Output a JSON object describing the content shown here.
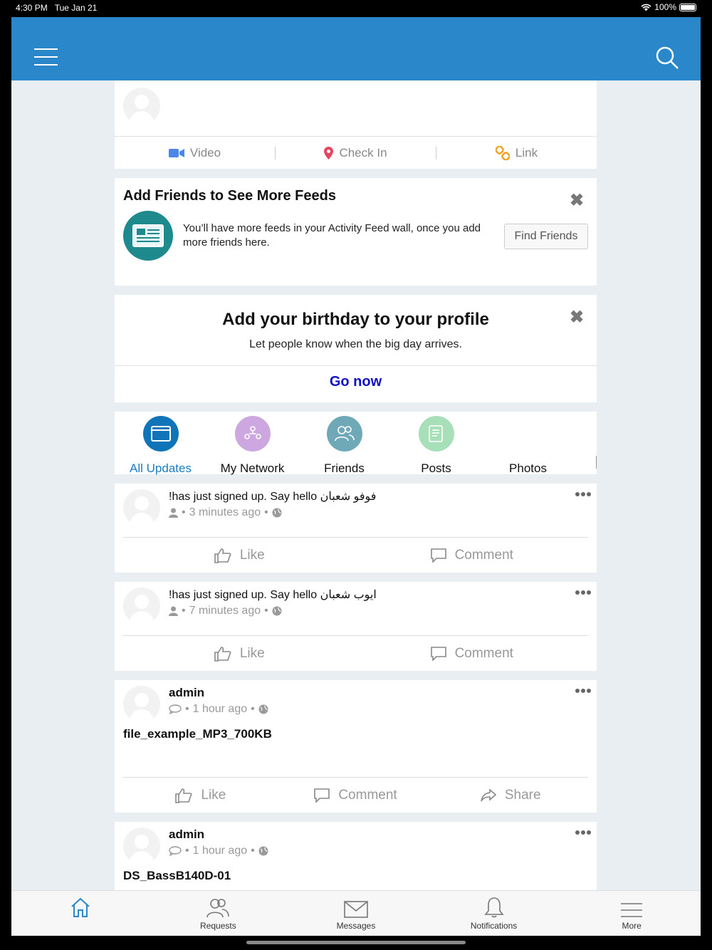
{
  "status": {
    "time": "4:30 PM",
    "date": "Tue Jan 21",
    "battery": "100%"
  },
  "composer": {
    "actions": [
      {
        "label": "Video",
        "icon": "video-icon"
      },
      {
        "label": "Check In",
        "icon": "location-pin-icon"
      },
      {
        "label": "Link",
        "icon": "link-icon"
      }
    ]
  },
  "add_friends": {
    "title": "Add Friends to See More Feeds",
    "text": "You’ll have more feeds in your Activity Feed wall, once you add more friends here.",
    "button": "Find Friends"
  },
  "birthday": {
    "title": "Add your birthday to your profile",
    "subtitle": "Let people know when the big day arrives.",
    "cta": "Go now"
  },
  "tabs": [
    {
      "label": "All Updates",
      "active": true,
      "color": "#0f74b8"
    },
    {
      "label": "My Network",
      "color": "#cda7df"
    },
    {
      "label": "Friends",
      "color": "#6fa9b8"
    },
    {
      "label": "Posts",
      "color": "#a6dfb8"
    },
    {
      "label": "Photos",
      "color": ""
    }
  ],
  "posts": [
    {
      "text": "!has just signed up. Say hello فوفو شعبان",
      "time": "3 minutes ago",
      "meta_icon": "user-icon"
    },
    {
      "text": "!has just signed up. Say hello ايوب شعبان",
      "time": "7 minutes ago",
      "meta_icon": "user-icon"
    },
    {
      "author": "admin",
      "time": "1 hour ago",
      "meta_icon": "comment-icon",
      "body": "file_example_MP3_700KB"
    },
    {
      "author": "admin",
      "time": "1 hour ago",
      "meta_icon": "comment-icon",
      "body": "DS_BassB140D-01"
    }
  ],
  "post_actions": {
    "like": "Like",
    "comment": "Comment",
    "share": "Share"
  },
  "bottom_nav": [
    {
      "label": "",
      "icon": "home-icon",
      "active": true
    },
    {
      "label": "Requests",
      "icon": "requests-icon"
    },
    {
      "label": "Messages",
      "icon": "mail-icon"
    },
    {
      "label": "Notifications",
      "icon": "bell-icon"
    },
    {
      "label": "More",
      "icon": "menu-icon"
    }
  ],
  "colors": {
    "brand": "#2a87c9",
    "link": "#1010c8",
    "active_tab": "#1a7cc0"
  }
}
